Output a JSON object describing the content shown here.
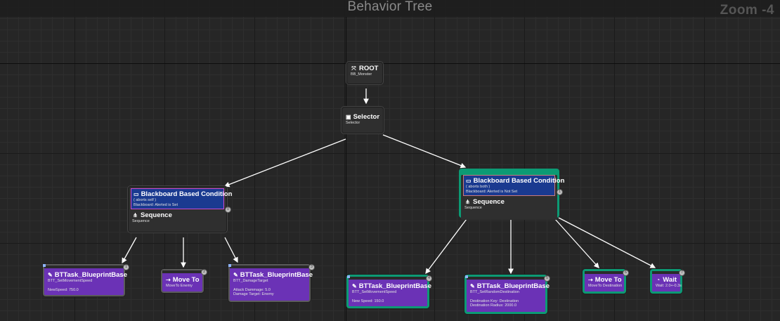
{
  "editor": {
    "title": "Behavior Tree",
    "zoom": "Zoom -4"
  },
  "nodes": {
    "root": {
      "title": "ROOT",
      "subtitle": "BB_Monster"
    },
    "selector": {
      "title": "Selector",
      "subtitle": "Selector"
    },
    "left_sequence": {
      "decorator_title": "Blackboard Based Condition",
      "decorator_line1": "( aborts self )",
      "decorator_line2": "Blackboard: Alerted is Set",
      "title": "Sequence",
      "subtitle": "Sequence"
    },
    "right_sequence": {
      "decorator_title": "Blackboard Based Condition",
      "decorator_line1": "( aborts both )",
      "decorator_line2": "Blackboard: Alerted is Not Set",
      "title": "Sequence",
      "subtitle": "Sequence"
    },
    "task_l1": {
      "title": "BTTask_BlueprintBase",
      "line1": "BTT_SetMovementSpeed",
      "line2": "NewSpeed: 750.0"
    },
    "task_l2": {
      "title": "Move To",
      "line1": "MoveTo Enemy"
    },
    "task_l3": {
      "title": "BTTask_BlueprintBase",
      "line1": "BTT_DamageTarget",
      "line2": "Attack Dammage: 5.0",
      "line3": "Damage Target: Enemy"
    },
    "task_r1": {
      "title": "BTTask_BlueprintBase",
      "line1": "BTT_SetMovementSpeed",
      "line2": "New Speed: 150.0"
    },
    "task_r2": {
      "title": "BTTask_BlueprintBase",
      "line1": "BTT_SetRandomDestination",
      "line2": "Destination Key: Destination",
      "line3": "Destination Radius: 2000.0"
    },
    "task_r3": {
      "title": "Move To",
      "line1": "MoveTo Destination"
    },
    "task_r4": {
      "title": "Wait",
      "line1": "Wait: 2.0+-0.3s"
    }
  },
  "execution_order": {
    "left_sequence": "0",
    "right_sequence": "1",
    "task_l1": "1",
    "task_l2": "2",
    "task_l3": "3",
    "task_r1": "4",
    "task_r2": "5",
    "task_r3": "6",
    "task_r4": "7"
  },
  "icons": {
    "root": "root-icon",
    "selector": "selector-icon",
    "decorator": "blackboard-icon",
    "sequence": "sequence-icon",
    "blueprint_task": "blueprint-task-icon",
    "move_to": "move-to-icon",
    "wait": "wait-icon"
  },
  "colors": {
    "active": "#0c9a74",
    "task": "#6b32b6",
    "decorator": "#1a3a90",
    "background": "#262626"
  }
}
